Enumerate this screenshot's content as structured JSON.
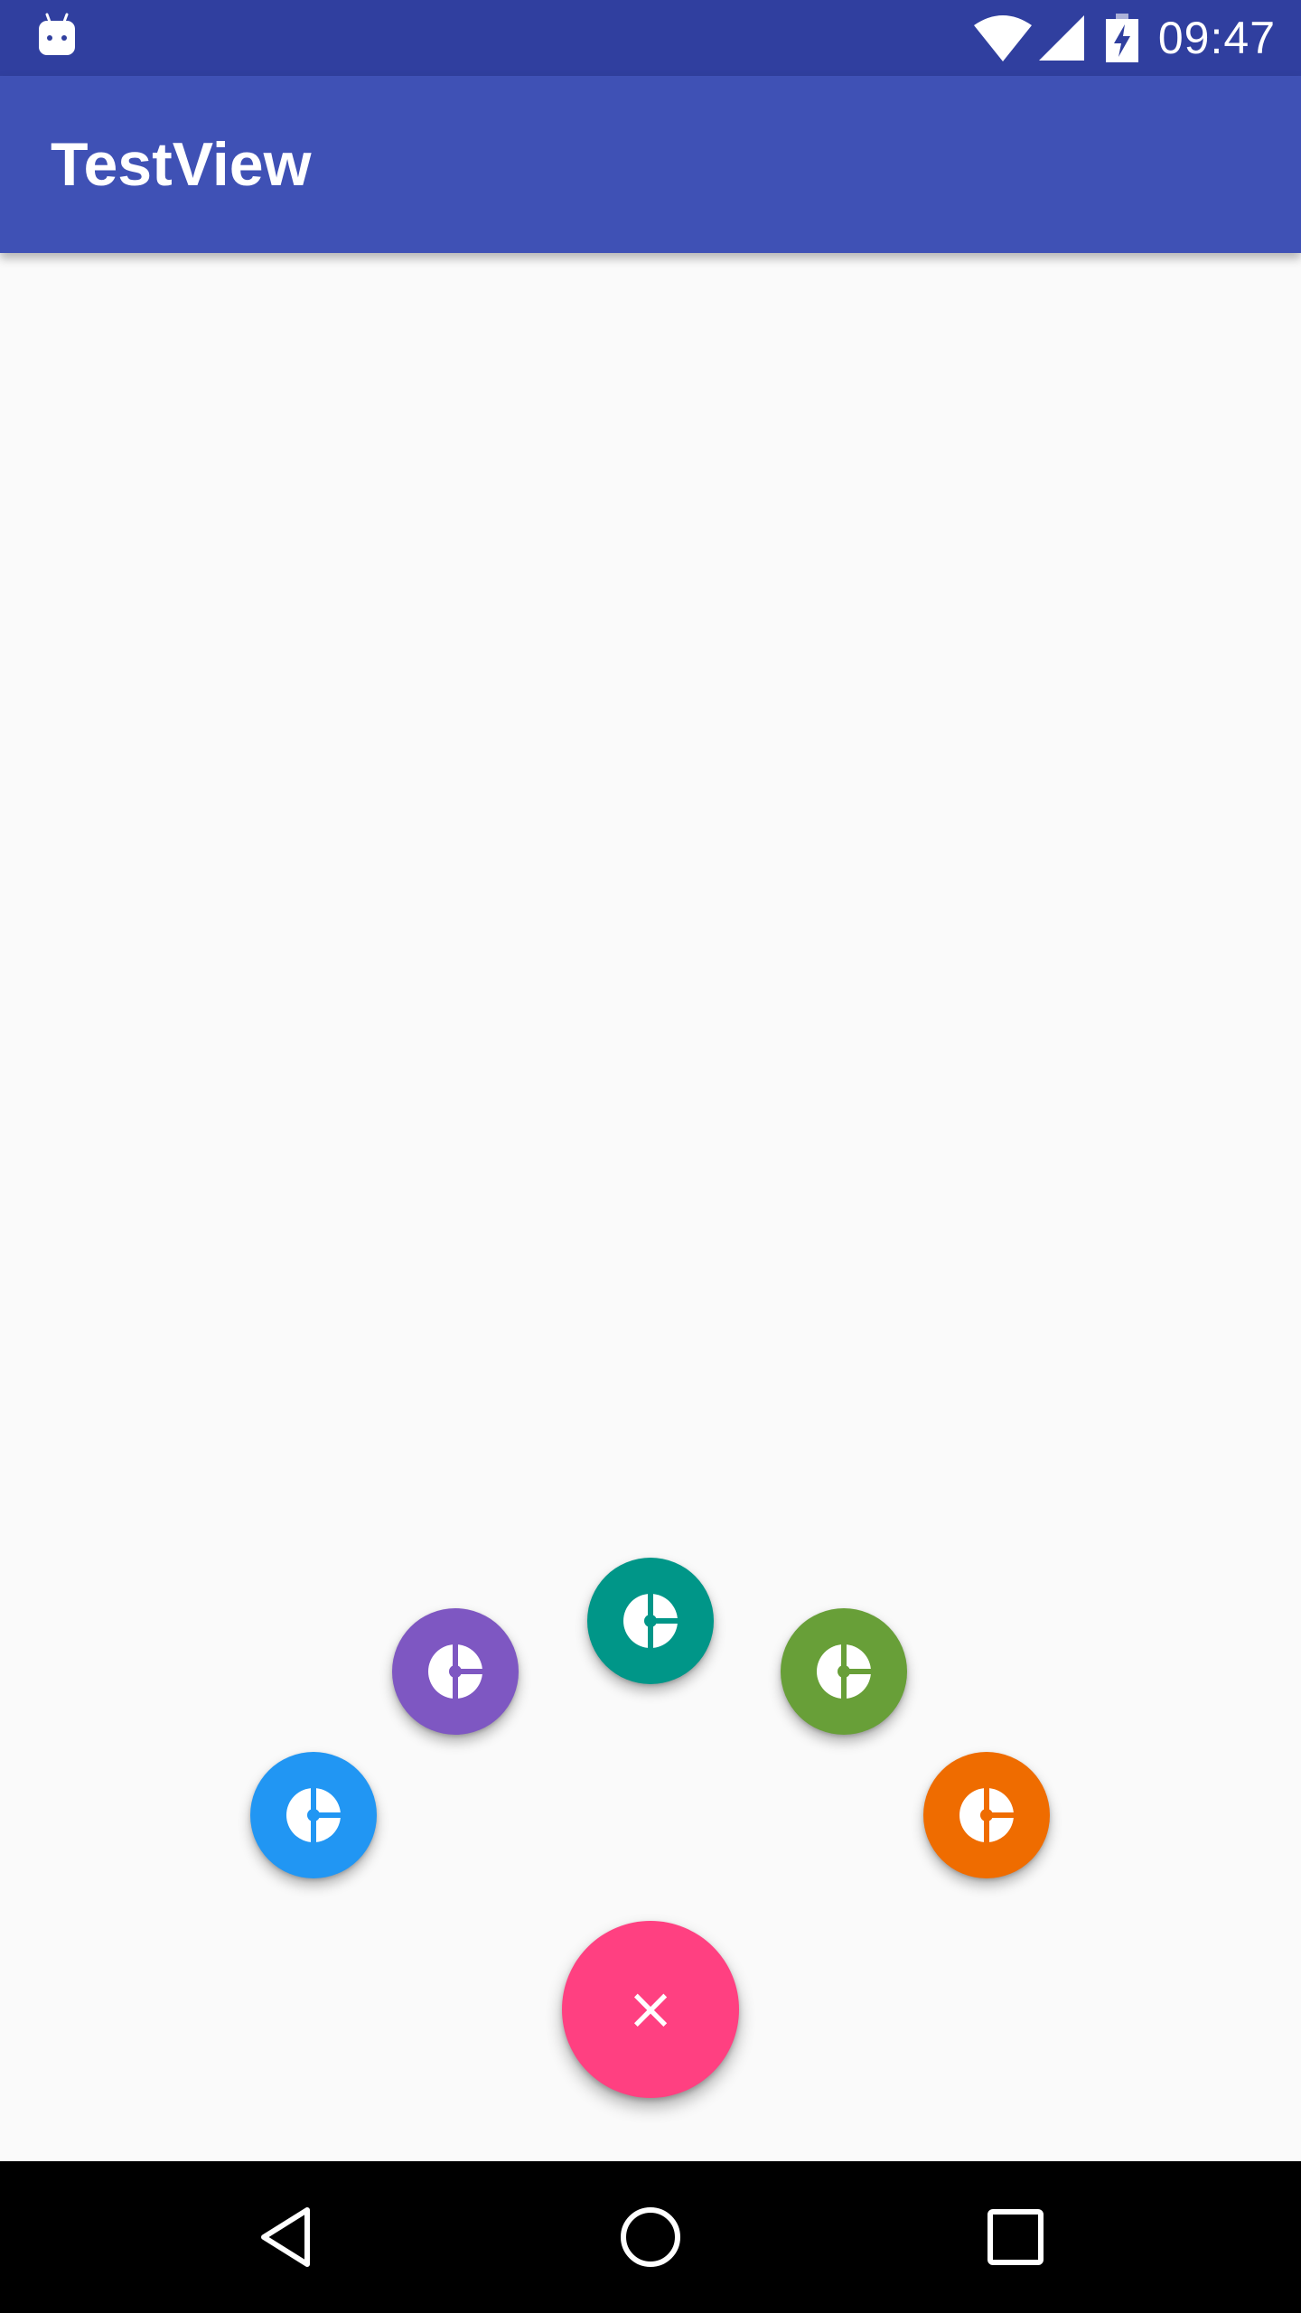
{
  "status_bar": {
    "time": "09:47",
    "icons": {
      "left": "android-debug-icon",
      "wifi": "wifi-icon",
      "signal": "signal-icon",
      "battery": "battery-charging-icon"
    }
  },
  "app_bar": {
    "title": "TestView",
    "color": "#3f51b5",
    "status_color": "#303f9f"
  },
  "fab_menu": {
    "main": {
      "glyph": "×",
      "icon": "close-icon",
      "color": "#ff4081"
    },
    "items": [
      {
        "icon": "pie-chart-icon",
        "color": "#2196f3"
      },
      {
        "icon": "pie-chart-icon",
        "color": "#7e57c2"
      },
      {
        "icon": "pie-chart-icon",
        "color": "#009688"
      },
      {
        "icon": "pie-chart-icon",
        "color": "#689f38"
      },
      {
        "icon": "pie-chart-icon",
        "color": "#ef6c00"
      }
    ]
  },
  "nav_bar": {
    "buttons": [
      "back-icon",
      "home-icon",
      "recents-icon"
    ]
  }
}
